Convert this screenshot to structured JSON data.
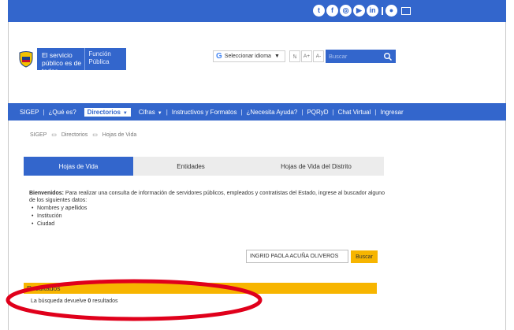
{
  "topbar": {
    "social_icons": [
      "twitter-icon",
      "facebook-icon",
      "instagram-icon",
      "youtube-icon",
      "linkedin-icon",
      "chat-icon",
      "mail-icon"
    ]
  },
  "header": {
    "gov_text": "El servicio público es de todos",
    "gov_sub": "Función Pública",
    "language": "Seleccionar idioma",
    "contrast_btn": "ℕ",
    "font_increase": "A+",
    "font_decrease": "A-",
    "search_placeholder": "Buscar"
  },
  "nav": {
    "items": [
      "SIGEP",
      "¿Qué es?",
      "Directorios",
      "Cifras",
      "Instructivos y Formatos",
      "¿Necesita Ayuda?",
      "PQRyD",
      "Chat Virtual",
      "Ingresar"
    ]
  },
  "breadcrumb": [
    "SIGEP",
    "Directorios",
    "Hojas de Vida"
  ],
  "tabs": [
    "Hojas de Vida",
    "Entidades",
    "Hojas de Vida del Distrito"
  ],
  "intro": {
    "bold": "Bienvenidos:",
    "text": " Para realizar una consulta de información de servidores públicos, empleados y contratistas del Estado, ingrese al buscador alguno de los siguientes datos:",
    "list": [
      "Nombres y apellidos",
      "Institución",
      "Ciudad"
    ]
  },
  "search_form": {
    "value": "INGRID PAOLA ACUÑA OLIVEROS",
    "button": "Buscar"
  },
  "results": {
    "title": "Resultados",
    "prefix": "La búsqueda devuelve ",
    "count": "0",
    "suffix": " resultados"
  },
  "colors": {
    "primary": "#3366cc",
    "accent": "#f7b500",
    "annotation": "#e0001b"
  }
}
